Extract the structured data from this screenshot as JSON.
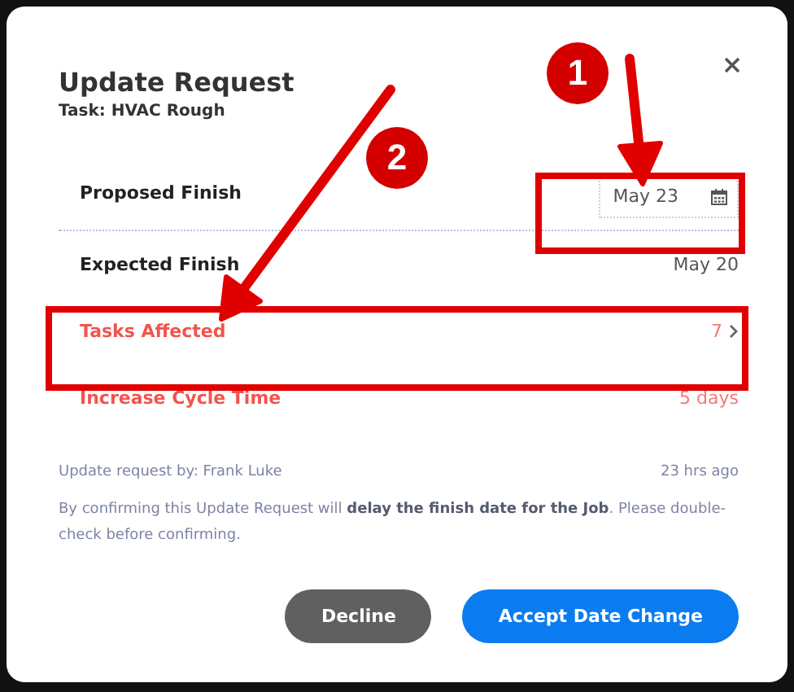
{
  "dialog": {
    "title": "Update Request",
    "subtitle": "Task: HVAC Rough"
  },
  "rows": [
    {
      "kind": "date-field",
      "label": "Proposed Finish",
      "value": "May 23",
      "alert": false
    },
    {
      "kind": "text",
      "label": "Expected Finish",
      "value": "May 20",
      "alert": false
    },
    {
      "kind": "link",
      "label": "Tasks Affected",
      "value": "7",
      "alert": true
    },
    {
      "kind": "text",
      "label": "Increase Cycle Time",
      "value": "5 days",
      "alert": true
    }
  ],
  "requested_by": "Update request by: Frank Luke",
  "requested_time": "23 hrs ago",
  "notice": "By confirming this Update Request will **delay the finish date for the Job**. Please double-check before confirming.",
  "buttons": [
    {
      "label": "Decline",
      "kind": "secondary"
    },
    {
      "label": "Accept Date Change",
      "kind": "primary"
    }
  ],
  "callouts": [
    {
      "label": "1"
    },
    {
      "label": "2"
    }
  ]
}
